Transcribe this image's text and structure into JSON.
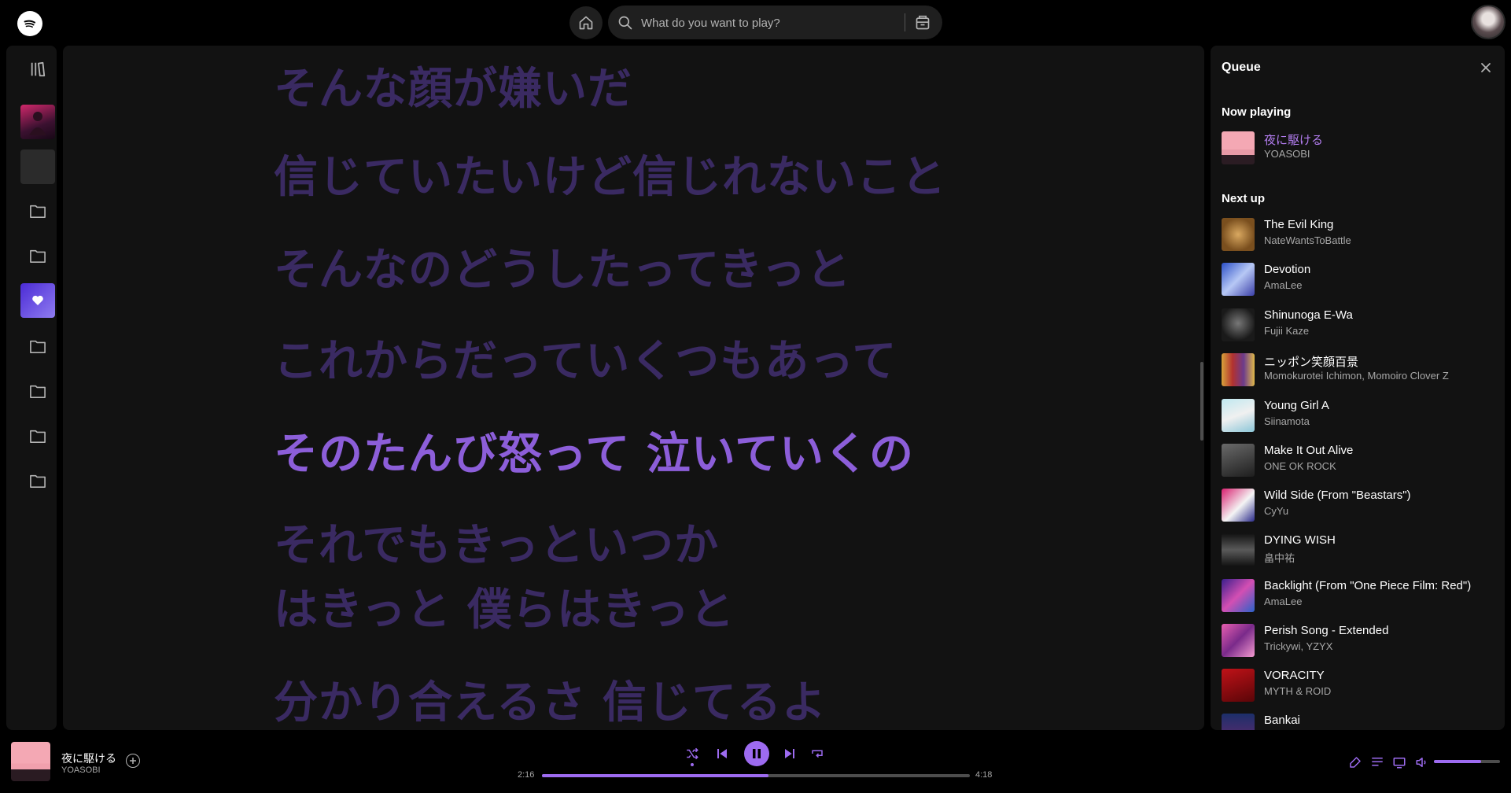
{
  "topbar": {
    "search_placeholder": "What do you want to play?"
  },
  "lyrics": [
    {
      "text": "そんな顔が嫌いだ",
      "active": false
    },
    {
      "text": "信じていたいけど信じれないこと",
      "active": false
    },
    {
      "text": "そんなのどうしたってきっと",
      "active": false
    },
    {
      "text": "これからだっていくつもあって",
      "active": false
    },
    {
      "text": "そのたんび怒って 泣いていくの",
      "active": true
    },
    {
      "text": "それでもきっといつか",
      "active": false
    },
    {
      "text": "はきっと 僕らはきっと",
      "active": false
    },
    {
      "text": "分かり合えるさ 信じてるよ",
      "active": false
    }
  ],
  "queue": {
    "title": "Queue",
    "now_playing_label": "Now playing",
    "now_playing": {
      "title": "夜に駆ける",
      "artist": "YOASOBI"
    },
    "next_up_label": "Next up",
    "items": [
      {
        "title": "The Evil King",
        "artist": "NateWantsToBattle"
      },
      {
        "title": "Devotion",
        "artist": "AmaLee"
      },
      {
        "title": "Shinunoga E-Wa",
        "artist": "Fujii Kaze"
      },
      {
        "title": "ニッポン笑顔百景",
        "artist": "Momokurotei Ichimon, Momoiro Clover Z"
      },
      {
        "title": "Young Girl A",
        "artist": "Siinamota"
      },
      {
        "title": "Make It Out Alive",
        "artist": "ONE OK ROCK"
      },
      {
        "title": "Wild Side (From \"Beastars\")",
        "artist": "CyYu"
      },
      {
        "title": "DYING WISH",
        "artist": "畠中祐"
      },
      {
        "title": "Backlight (From \"One Piece Film: Red\")",
        "artist": "AmaLee"
      },
      {
        "title": "Perish Song - Extended",
        "artist": "Trickywi, YZYX"
      },
      {
        "title": "VORACITY",
        "artist": "MYTH & ROID"
      },
      {
        "title": "Bankai",
        "artist": ""
      }
    ]
  },
  "player": {
    "title": "夜に駆ける",
    "artist": "YOASOBI",
    "time_current": "2:16",
    "time_total": "4:18",
    "progress": 0.53,
    "volume": 0.72
  },
  "colors": {
    "accent": "#9d6bf0",
    "lyric_dim": "#3a2a62",
    "lyric_active": "#8c5ed9"
  }
}
